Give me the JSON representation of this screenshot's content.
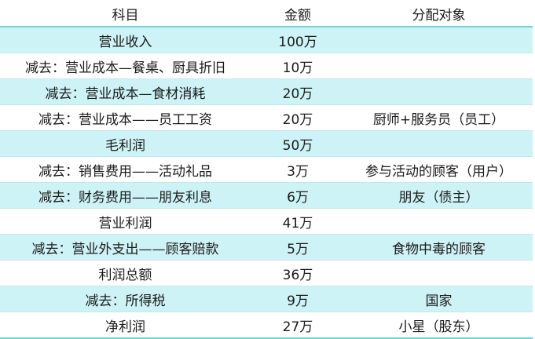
{
  "table": {
    "headers": [
      "科目",
      "金额",
      "分配对象"
    ],
    "rows": [
      [
        "营业收入",
        "100万",
        ""
      ],
      [
        "减去：营业成本—餐桌、厨具折旧",
        "10万",
        ""
      ],
      [
        "减去：营业成本—食材消耗",
        "20万",
        ""
      ],
      [
        "减去：营业成本——员工工资",
        "20万",
        "厨师+服务员（员工）"
      ],
      [
        "毛利润",
        "50万",
        ""
      ],
      [
        "减去：销售费用——活动礼品",
        "3万",
        "参与活动的顾客（用户）"
      ],
      [
        "减去：财务费用——朋友利息",
        "6万",
        "朋友（债主）"
      ],
      [
        "营业利润",
        "41万",
        ""
      ],
      [
        "减去：营业外支出——顾客赔款",
        "5万",
        "食物中毒的顾客"
      ],
      [
        "利润总额",
        "36万",
        ""
      ],
      [
        "减去：所得税",
        "9万",
        "国家"
      ],
      [
        "净利润",
        "27万",
        "小星（股东）"
      ]
    ]
  },
  "colors": {
    "stripe": "#cef3f6",
    "border": "#6fd1d6"
  }
}
